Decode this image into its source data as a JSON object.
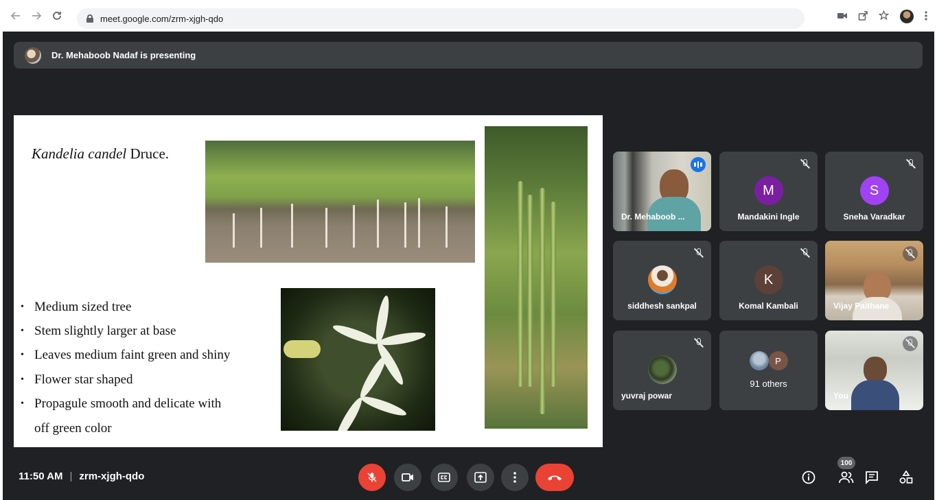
{
  "browser": {
    "url": "meet.google.com/zrm-xjgh-qdo",
    "back_icon": "back-arrow-icon",
    "forward_icon": "forward-arrow-icon",
    "reload_icon": "reload-icon"
  },
  "presenting_bar": {
    "text": "Dr. Mehaboob Nadaf is presenting"
  },
  "slide": {
    "title_italic": "Kandelia candel",
    "title_rest": " Druce.",
    "bullets": [
      "Medium sized tree",
      "Stem slightly larger at base",
      "Leaves medium faint green and shiny",
      "Flower star shaped",
      "Propagule smooth and delicate with"
    ],
    "bullet_continuation": "off green color"
  },
  "participants": [
    {
      "name": "Dr. Mehaboob ...",
      "type": "video",
      "speaking": true
    },
    {
      "name": "Mandakini Ingle",
      "type": "initial",
      "initial": "M",
      "color": "#7b1fa2"
    },
    {
      "name": "Sneha Varadkar",
      "type": "initial",
      "initial": "S",
      "color": "#a142f4"
    },
    {
      "name": "siddhesh sankpal",
      "type": "photo"
    },
    {
      "name": "Komal Kambali",
      "type": "initial",
      "initial": "K",
      "color": "#5d4037"
    },
    {
      "name": "Vijay Paithane",
      "type": "video"
    },
    {
      "name": "yuvraj powar",
      "type": "photo"
    },
    {
      "name": "91 others",
      "type": "others",
      "initial": "P",
      "color": "#795548"
    },
    {
      "name": "You",
      "type": "video"
    }
  ],
  "bottom_bar": {
    "time": "11:50 AM",
    "separator": "|",
    "meeting_code": "zrm-xjgh-qdo",
    "people_count": "100"
  },
  "colors": {
    "meet_background": "#202124",
    "tile_background": "#3c4043",
    "danger_red": "#ea4335",
    "speaking_blue": "#1a73e8"
  }
}
